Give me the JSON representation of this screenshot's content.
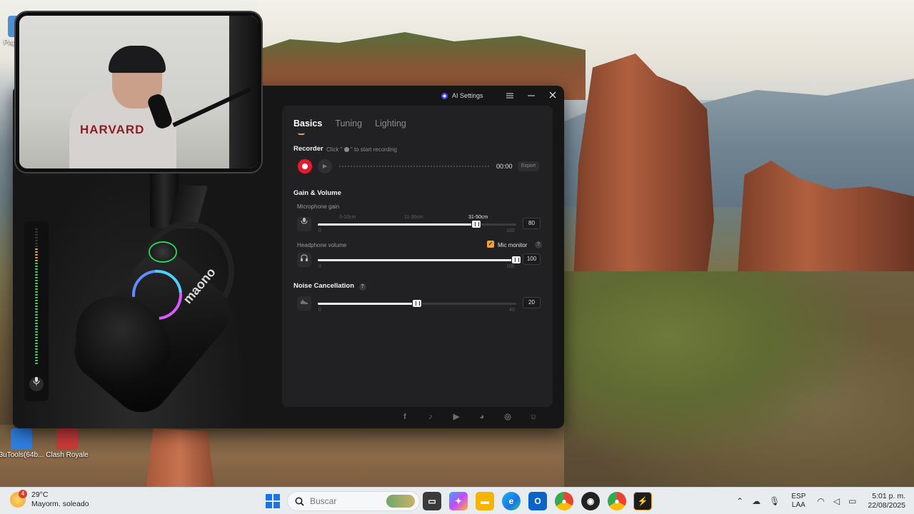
{
  "desktop": {
    "icons": [
      {
        "label": "Papel\nrec",
        "color": "#4b8fd6"
      },
      {
        "label": "3uTools(64b...",
        "color": "#2f7fe0"
      },
      {
        "label": "Clash Royale",
        "color": "#c93a3a"
      }
    ]
  },
  "window": {
    "ai_settings_label": "AI Settings",
    "menu_icon": "hamburger-icon",
    "minimize_icon": "minimize-icon",
    "close_icon": "close-icon"
  },
  "device": {
    "brand": "maono",
    "vu_levels": 0.86
  },
  "panel": {
    "tabs": [
      {
        "label": "Basics",
        "active": true
      },
      {
        "label": "Tuning",
        "active": false
      },
      {
        "label": "Lighting",
        "active": false
      }
    ],
    "recorder": {
      "title": "Recorder",
      "hint_before": "Click \"",
      "hint_after": "\" to start recording",
      "time": "00:00",
      "export_label": "Export"
    },
    "gain_volume": {
      "title": "Gain & Volume",
      "mic_gain": {
        "label": "Microphone gain",
        "value": 80,
        "min": "0",
        "max": "100",
        "zones": [
          {
            "label": "0-10cm",
            "active": false
          },
          {
            "label": "11-30cm",
            "active": false
          },
          {
            "label": "31-50cm",
            "active": true
          }
        ]
      },
      "headphone": {
        "label": "Headphone volume",
        "value": 100,
        "min": "0",
        "max": "100",
        "mic_monitor_label": "Mic monitor",
        "mic_monitor_checked": true
      }
    },
    "noise": {
      "title": "Noise Cancellation",
      "value": 20,
      "min": "0",
      "max": "40"
    }
  },
  "social_icons": [
    "facebook-icon",
    "tiktok-icon",
    "youtube-icon",
    "discord-icon",
    "instagram-icon",
    "chat-icon"
  ],
  "taskbar": {
    "weather_temp": "29°C",
    "weather_desc": "Mayorm. soleado",
    "weather_badge": "4",
    "search_placeholder": "Buscar",
    "lang_top": "ESP",
    "lang_bottom": "LAA",
    "time": "5:01 p. m.",
    "date": "22/08/2025"
  }
}
